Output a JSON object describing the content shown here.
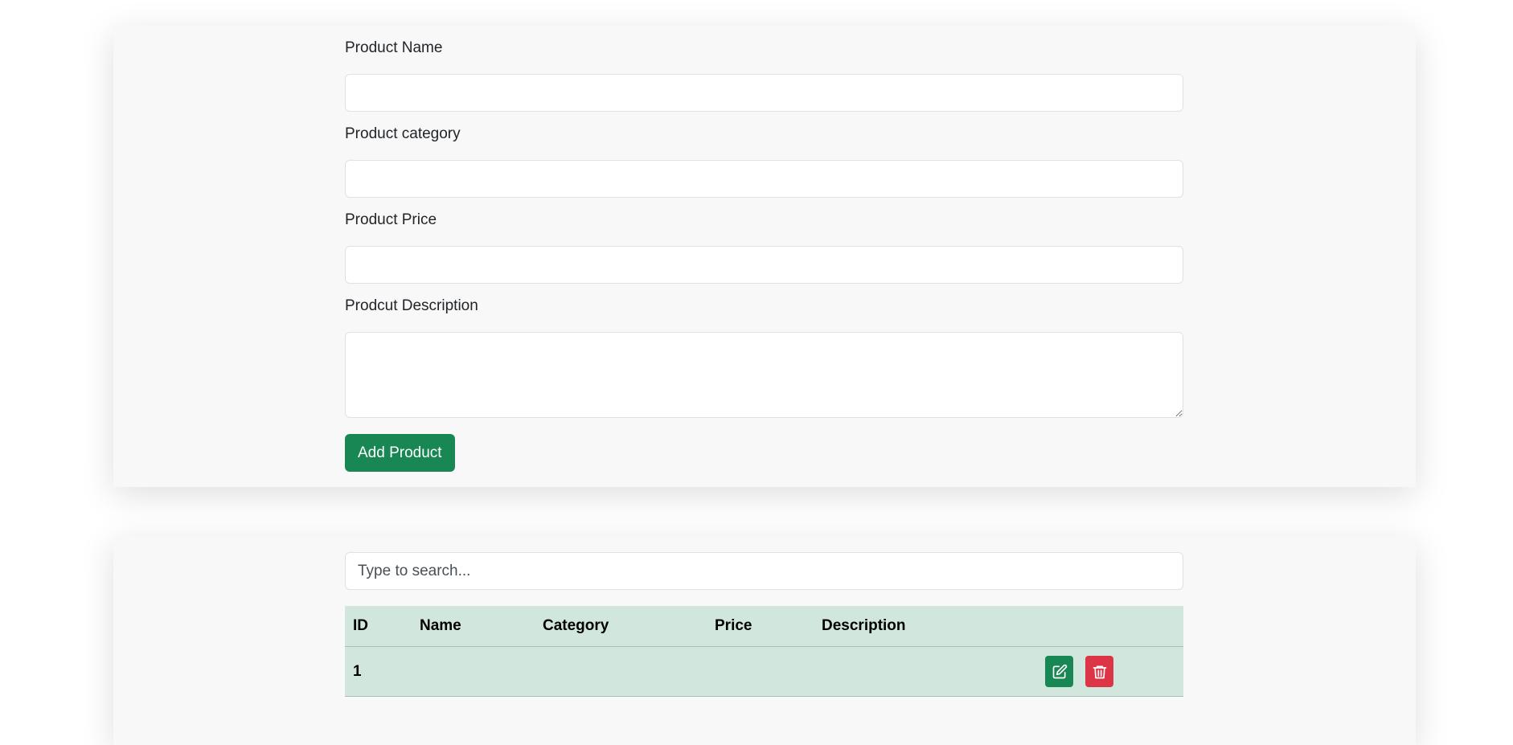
{
  "form": {
    "name_label": "Product Name",
    "name_value": "",
    "category_label": "Product category",
    "category_value": "",
    "price_label": "Product Price",
    "price_value": "",
    "description_label": "Prodcut Description",
    "description_value": "",
    "submit_label": "Add Product"
  },
  "search": {
    "placeholder": "Type to search...",
    "value": ""
  },
  "table": {
    "columns": [
      "ID",
      "Name",
      "Category",
      "Price",
      "Description",
      ""
    ],
    "rows": [
      {
        "id": "1",
        "name": "",
        "category": "",
        "price": "",
        "description": "",
        "actions": [
          "edit-icon",
          "trash-icon"
        ]
      }
    ]
  },
  "colors": {
    "card_bg": "#f8f8f8",
    "accent_green": "#198754",
    "danger_red": "#dc3545",
    "table_bg": "#d1e7dd"
  }
}
